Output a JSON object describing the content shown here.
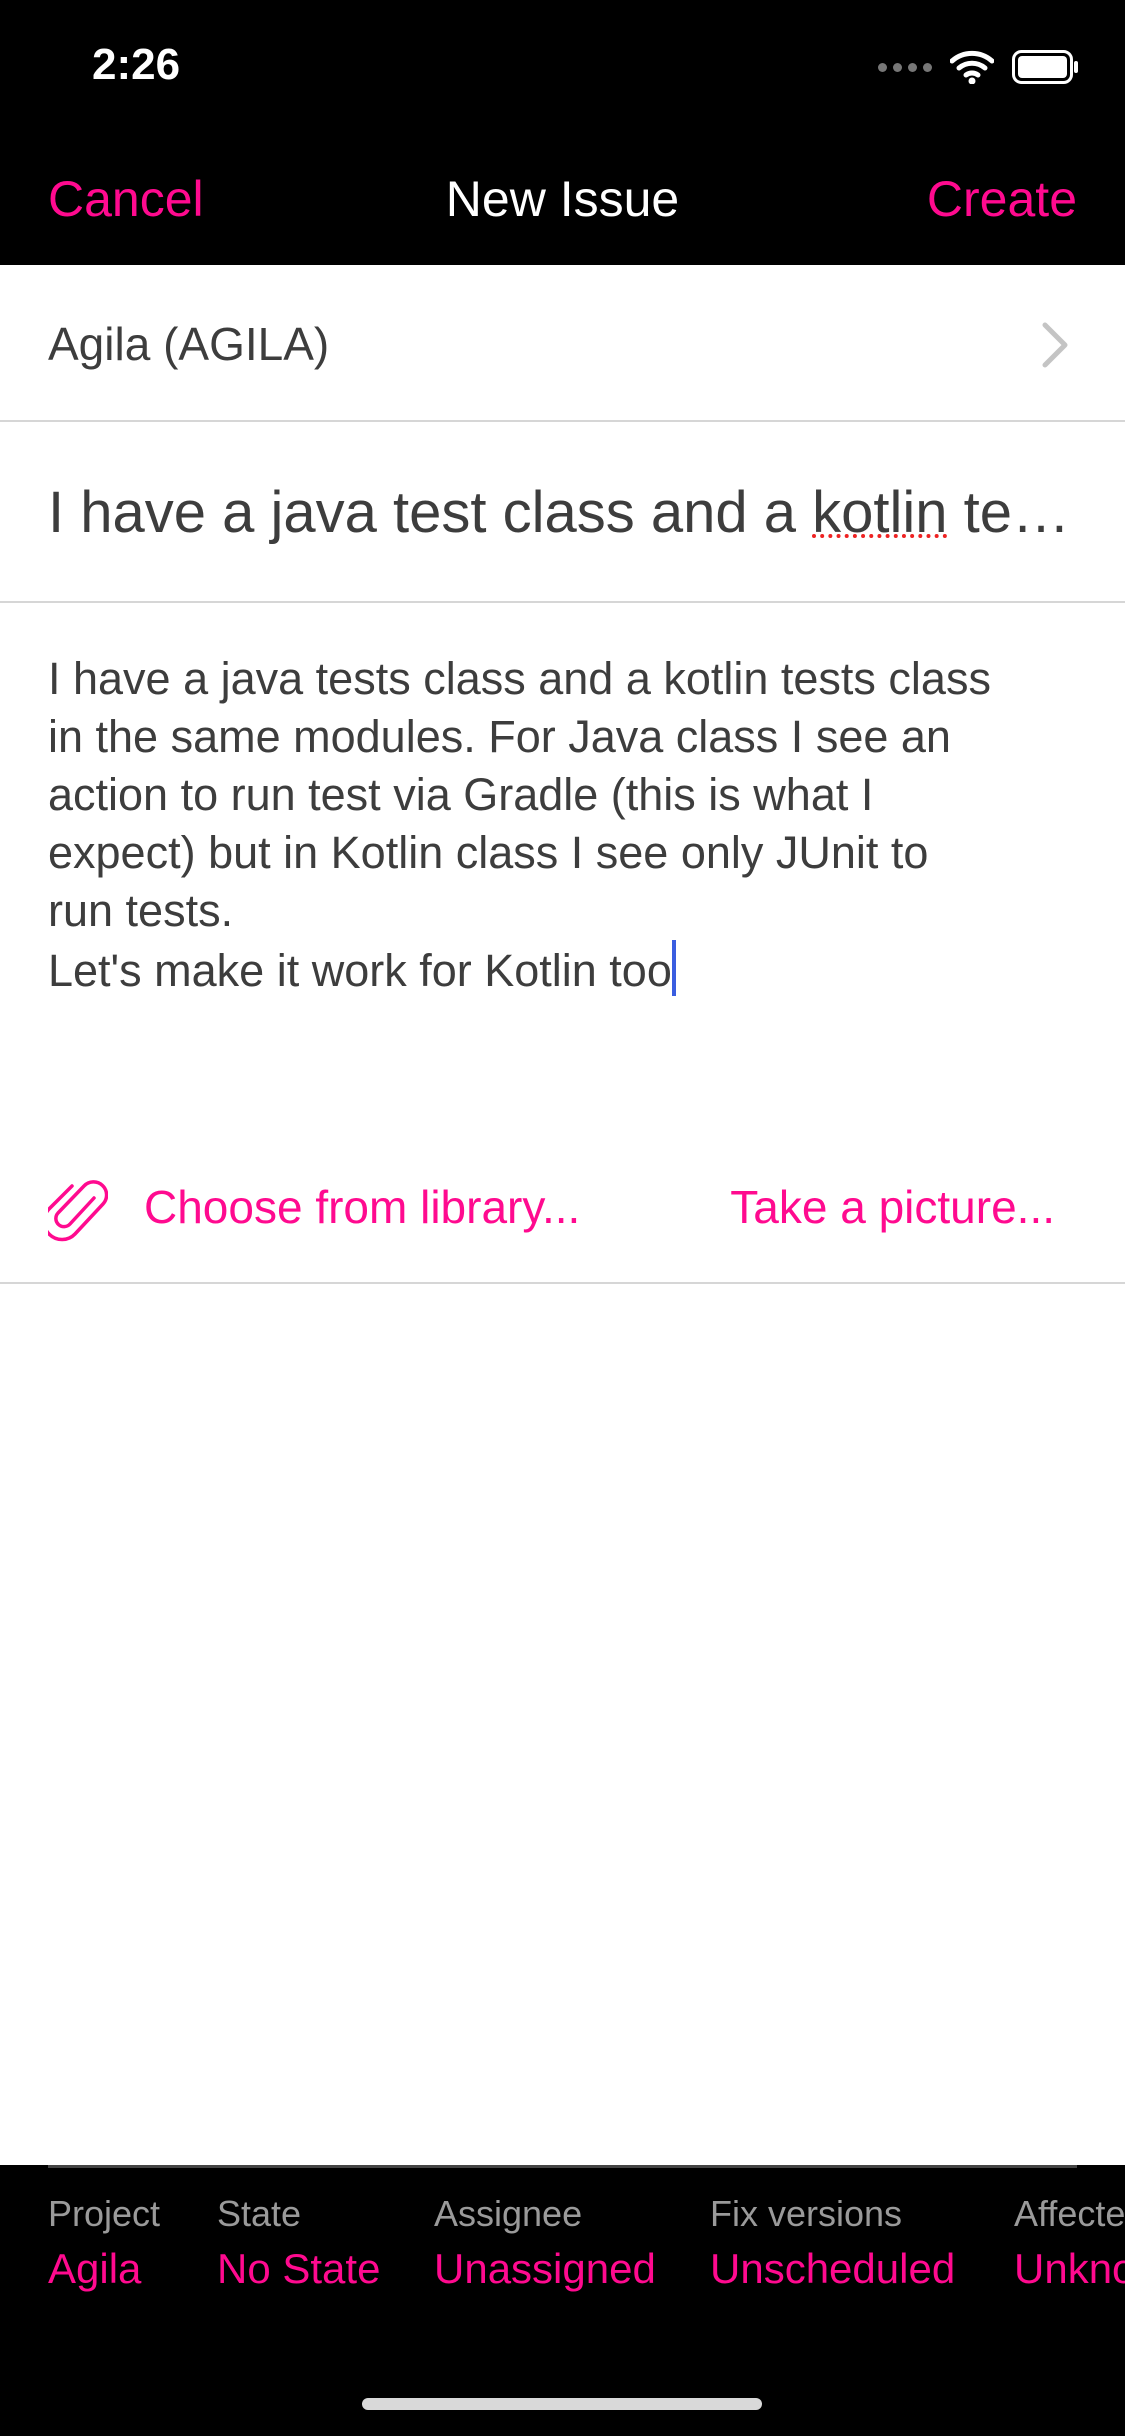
{
  "status_bar": {
    "time": "2:26",
    "icons": [
      "signal-dots-icon",
      "wifi-icon",
      "battery-icon"
    ]
  },
  "nav": {
    "cancel": "Cancel",
    "title": "New Issue",
    "create": "Create"
  },
  "project_row": {
    "label": "Agila (AGILA)",
    "icon": "chevron-right-icon"
  },
  "summary": {
    "before": "I have a java test class and a ",
    "misspelled": "kotlin",
    "after": " tes…"
  },
  "description": {
    "lines": [
      "I have a java tests class and a kotlin tests class",
      "in the same modules. For Java class I see an",
      "action to run test via Gradle (this is what I",
      "expect) but in Kotlin class I see only JUnit to",
      "run tests.",
      "Let's make it work for Kotlin too"
    ]
  },
  "attachments": {
    "icon": "paperclip-icon",
    "choose": "Choose from library...",
    "picture": "Take a picture..."
  },
  "fields": [
    {
      "name": "Project",
      "value": "Agila"
    },
    {
      "name": "State",
      "value": "No State"
    },
    {
      "name": "Assignee",
      "value": "Unassigned"
    },
    {
      "name": "Fix versions",
      "value": "Unscheduled"
    },
    {
      "name": "Affected versions",
      "value": "Unknown"
    }
  ],
  "colors": {
    "accent": "#ff0a8f",
    "bar": "#000000",
    "text": "#3d3d3d",
    "caret": "#3a5de0"
  }
}
